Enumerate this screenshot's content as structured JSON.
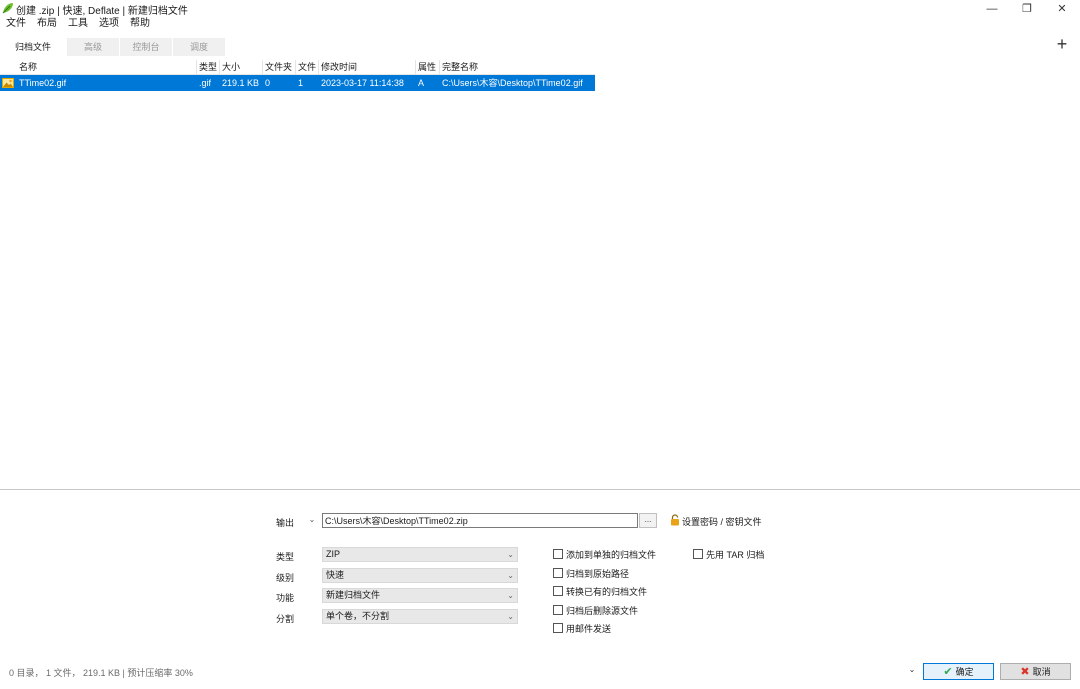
{
  "window": {
    "title": "创建 .zip | 快速, Deflate | 新建归档文件",
    "icon": "leaf-icon",
    "minimize_glyph": "—",
    "restore_glyph": "❐",
    "close_glyph": "✕"
  },
  "menu": [
    "文件",
    "布局",
    "工具",
    "选项",
    "帮助"
  ],
  "tabs": [
    {
      "label": "归档文件",
      "active": true
    },
    {
      "label": "高级",
      "active": false
    },
    {
      "label": "控制台",
      "active": false
    },
    {
      "label": "调度",
      "active": false
    }
  ],
  "add_button": "+",
  "table": {
    "columns": [
      "名称",
      "类型",
      "大小",
      "文件夹",
      "文件",
      "修改时间",
      "属性",
      "完整名称"
    ],
    "rows": [
      {
        "name": "TTime02.gif",
        "type": ".gif",
        "size": "219.1 KB",
        "folders": "0",
        "files": "1",
        "modified": "2023-03-17 11:14:38",
        "attr": "A",
        "fullname": "C:\\Users\\木容\\Desktop\\TTime02.gif",
        "icon": "gif-image-icon"
      }
    ]
  },
  "output": {
    "label": "输出",
    "path": "C:\\Users\\木容\\Desktop\\TTime02.zip",
    "browse_label": "...",
    "password_label": "设置密码 / 密钥文件"
  },
  "options": {
    "type": {
      "label": "类型",
      "value": "ZIP"
    },
    "level": {
      "label": "级别",
      "value": "快速"
    },
    "function": {
      "label": "功能",
      "value": "新建归档文件"
    },
    "split": {
      "label": "分割",
      "value": "单个卷，不分割"
    }
  },
  "checkboxes": [
    {
      "label": "添加到单独的归档文件",
      "checked": false
    },
    {
      "label": "归档到原始路径",
      "checked": false
    },
    {
      "label": "转换已有的归档文件",
      "checked": false
    },
    {
      "label": "归档后删除源文件",
      "checked": false
    },
    {
      "label": "用邮件发送",
      "checked": false
    }
  ],
  "tar_checkbox": {
    "label": "先用 TAR 归档",
    "checked": false
  },
  "status": "0 目录， 1 文件， 219.1 KB | 预计压缩率 30%",
  "buttons": {
    "ok": "确定",
    "cancel": "取消"
  },
  "colors": {
    "selection": "#0078d7",
    "ok_icon": "#2fa84f",
    "cancel_icon": "#d9352b",
    "lock": "#e8a317"
  }
}
